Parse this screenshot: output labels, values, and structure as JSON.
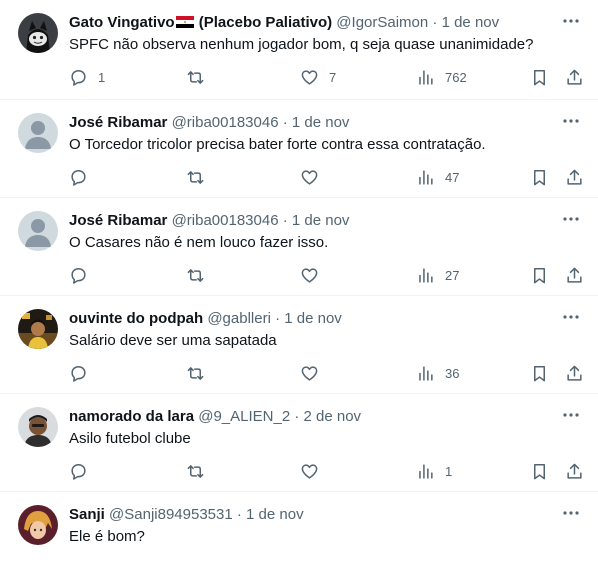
{
  "tweets": [
    {
      "name": "Gato Vingativo",
      "name_suffix": "(Placebo Paliativo)",
      "handle": "@IgorSaimon",
      "date": "1 de nov",
      "text": "SPFC não observa nenhum jogador bom, q seja quase unanimidade?",
      "replies": "1",
      "retweets": "",
      "likes": "7",
      "views": "762"
    },
    {
      "name": "José Ribamar",
      "handle": "@riba00183046",
      "date": "1 de nov",
      "text": "O Torcedor tricolor precisa bater forte contra essa contratação.",
      "replies": "",
      "retweets": "",
      "likes": "",
      "views": "47"
    },
    {
      "name": "José Ribamar",
      "handle": "@riba00183046",
      "date": "1 de nov",
      "text": "O Casares não é nem louco fazer isso.",
      "replies": "",
      "retweets": "",
      "likes": "",
      "views": "27"
    },
    {
      "name": "ouvinte do podpah",
      "handle": "@gablleri",
      "date": "1 de nov",
      "text": "Salário deve ser uma sapatada",
      "replies": "",
      "retweets": "",
      "likes": "",
      "views": "36"
    },
    {
      "name": "namorado da lara",
      "handle": "@9_ALIEN_2",
      "date": "2 de nov",
      "text": "Asilo futebol clube",
      "replies": "",
      "retweets": "",
      "likes": "",
      "views": "1"
    },
    {
      "name": "Sanji",
      "handle": "@Sanji894953531",
      "date": "1 de nov",
      "text": "Ele é bom?"
    }
  ],
  "separator": "·",
  "icons": {
    "reply": "reply-icon",
    "retweet": "retweet-icon",
    "like": "heart-icon",
    "views": "views-chart-icon",
    "bookmark": "bookmark-icon",
    "share": "share-icon",
    "more": "more-dots-icon",
    "flag": "egypt-flag-icon"
  },
  "colors": {
    "text": "#0f1419",
    "muted": "#536471",
    "divider": "#eff3f4"
  }
}
